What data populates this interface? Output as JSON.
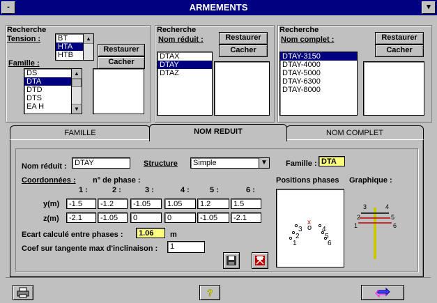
{
  "window": {
    "title": "ARMEMENTS",
    "sys_menu": "-",
    "dropdown": "▾"
  },
  "search_tension": {
    "group_label": "Recherche",
    "tension_label": "Tension :",
    "tension_options": [
      "BT",
      "HTA",
      "HTB"
    ],
    "tension_selected": "HTA",
    "famille_label": "Famille :",
    "famille_items": [
      "DS",
      "DTA",
      "DTD",
      "DTS",
      "EA H"
    ],
    "famille_selected": "DTA",
    "restaurer": "Restaurer",
    "cacher": "Cacher"
  },
  "search_nom_reduit": {
    "group_label": "Recherche",
    "nom_label": "Nom réduit :",
    "items": [
      "DTAX",
      "DTAY",
      "DTAZ"
    ],
    "selected": "DTAY",
    "restaurer": "Restaurer",
    "cacher": "Cacher"
  },
  "search_nom_complet": {
    "group_label": "Recherche",
    "nom_label": "Nom complet :",
    "items": [
      "DTAY-3150",
      "DTAY-4000",
      "DTAY-5000",
      "DTAY-6300",
      "DTAY-8000"
    ],
    "selected": "DTAY-3150",
    "restaurer": "Restaurer",
    "cacher": "Cacher"
  },
  "tabs": [
    {
      "label": "FAMILLE",
      "active": false
    },
    {
      "label": "NOM REDUIT",
      "active": true
    },
    {
      "label": "NOM COMPLET",
      "active": false
    }
  ],
  "form": {
    "nom_reduit_label": "Nom réduit :",
    "nom_reduit_value": "DTAY",
    "structure_label": "Structure",
    "structure_value": "Simple",
    "famille_label": "Famille :",
    "famille_value": "DTA",
    "coordonnees_label": "Coordonnées :",
    "phase_label": "n° de phase :",
    "phase_numbers": [
      "1 :",
      "2 :",
      "3 :",
      "4 :",
      "5 :",
      "6 :"
    ],
    "y_label": "y(m)",
    "z_label": "z(m)",
    "y_values": [
      "-1.5",
      "-1.2",
      "-1.05",
      "1.05",
      "1.2",
      "1.5"
    ],
    "z_values": [
      "-2.1",
      "-1.05",
      "0",
      "0",
      "-1.05",
      "-2.1"
    ],
    "ecart_label": "Ecart calculé entre phases :",
    "ecart_value": "1.06",
    "ecart_unit": "m",
    "coef_label": "Coef sur tangente max d'inclinaison :",
    "coef_value": "1",
    "positions_label": "Positions phases",
    "graphique_label": "Graphique :",
    "phase_marks": [
      "1",
      "2",
      "3",
      "4",
      "5",
      "6"
    ],
    "center_mark": "o",
    "cross_mark": "x",
    "graph_labels": [
      "3",
      "4",
      "2",
      "5",
      "1",
      "6"
    ]
  },
  "colors": {
    "title_bg": "#000080",
    "selection": "#000080",
    "face": "#c0c0c0",
    "highlight_field": "#ffff80",
    "pole": "#c8c800",
    "arm_red": "#c00000"
  },
  "toolbar": {
    "print_icon": "printer-icon",
    "help_icon": "help-icon",
    "exit_icon": "exit-icon"
  }
}
